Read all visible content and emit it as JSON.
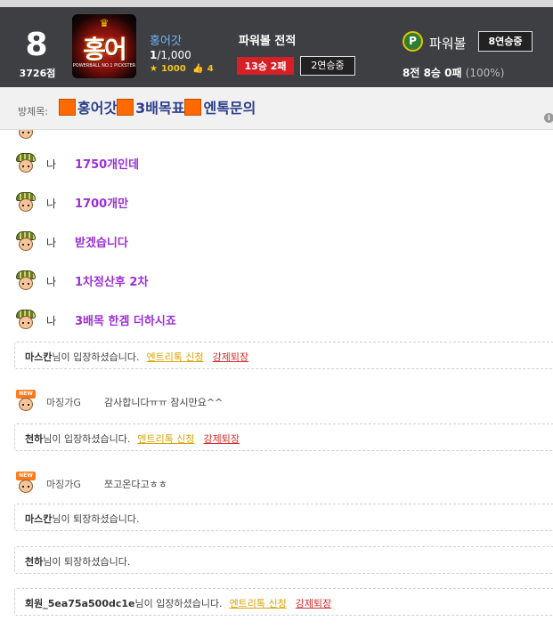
{
  "profile": {
    "level": "8",
    "points": "3726점",
    "logo_text": "홍어",
    "logo_sub": "POWERBALL NO.1 PICKSTER",
    "room_name": "홍어갓",
    "rank_current": "1",
    "rank_total": "/1,000",
    "stars": "1000",
    "likes": "4"
  },
  "powerball": {
    "title": "파워볼 전적",
    "record_badge": "13승 2패",
    "streak_badge": "2연승중",
    "icon_letter": "P",
    "label": "파워볼",
    "streak_right": "8연승중",
    "record": "8전 8승 0패",
    "percent": "(100%)"
  },
  "room": {
    "title_label": "방제목:",
    "title_parts": [
      "홍어갓",
      "3배목표",
      "엔톡문의"
    ],
    "info_icon": "i"
  },
  "messages": [
    {
      "sender": "나",
      "text": "1750개인데"
    },
    {
      "sender": "나",
      "text": "1700개만"
    },
    {
      "sender": "나",
      "text": "받겠습니다"
    },
    {
      "sender": "나",
      "text": "1차정산후 2차"
    },
    {
      "sender": "나",
      "text": "3배목 한겜 더하시죠"
    }
  ],
  "system": [
    {
      "user": "마스칸",
      "suffix": "님이 입장하셨습니다.",
      "entry": "엔트리톡 신청",
      "kick": "강제퇴장"
    },
    {
      "user": "천하",
      "suffix": "님이 입장하셨습니다.",
      "entry": "엔트리톡 신청",
      "kick": "강제퇴장"
    },
    {
      "user": "마스칸",
      "suffix": "님이 퇴장하셨습니다."
    },
    {
      "user": "천하",
      "suffix": "님이 퇴장하셨습니다."
    },
    {
      "user": "회원_5ea75a500dc1e",
      "suffix": "님이 입장하셨습니다.",
      "entry": "엔트리톡 신청",
      "kick": "강제퇴장"
    }
  ],
  "user_messages": [
    {
      "tag": "NEW",
      "sender": "마징가G",
      "text": "감사합니다ㅠㅠ 잠시만요^^"
    },
    {
      "tag": "NEW",
      "sender": "마징가G",
      "text": "쪼고온다고ㅎㅎ"
    }
  ],
  "colors": {
    "header_bg": "#3d3f42",
    "chat_purple": "#9b30d9",
    "entry_yellow": "#d9a400",
    "kick_red": "#d62b2b",
    "badge_red": "#d61f26"
  }
}
